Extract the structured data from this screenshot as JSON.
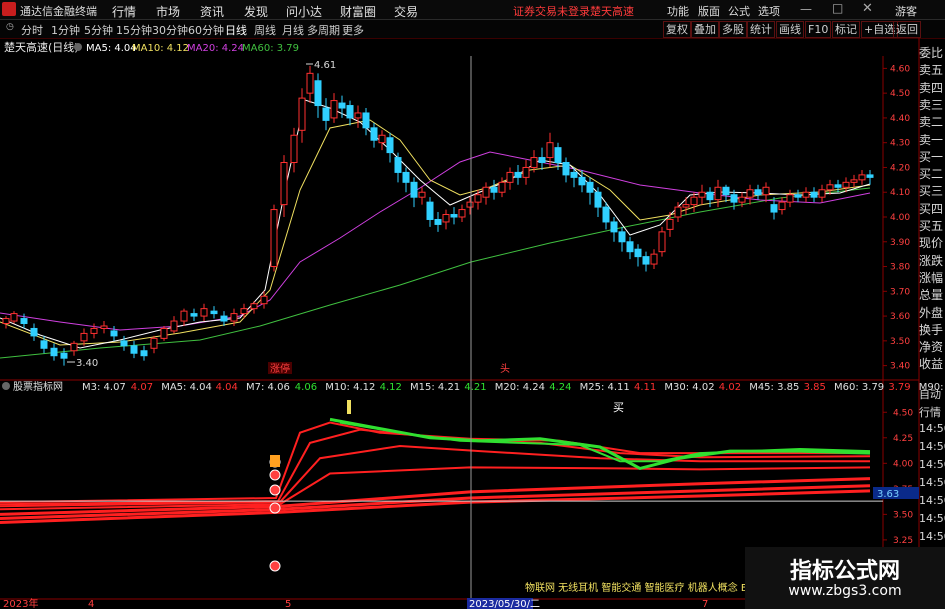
{
  "app": {
    "title": "通达信金融终端"
  },
  "menu": [
    "行情",
    "市场",
    "资讯",
    "发现",
    "问小达",
    "财富圈",
    "交易"
  ],
  "alerts": [
    "证券交易未登录",
    "楚天高速"
  ],
  "right_menu": [
    "功能",
    "版面",
    "公式",
    "选项",
    "游客"
  ],
  "periods": [
    "分时",
    "1分钟",
    "5分钟",
    "15分钟",
    "30分钟",
    "60分钟",
    "日线",
    "周线",
    "月线",
    "多周期",
    "更多"
  ],
  "tools": [
    "复权",
    "叠加",
    "多股",
    "统计",
    "画线",
    "F10",
    "标记",
    "+自选",
    "返回"
  ],
  "main_chart": {
    "stock_label": "楚天高速(日线)",
    "ma_labels": [
      "MA5: 4.04",
      "MA10: 4.12",
      "MA20: 4.24",
      "MA60: 3.79"
    ],
    "ma_colors": [
      "#ffffff",
      "#f0e060",
      "#d040e0",
      "#40c040"
    ],
    "price_axis": [
      "4.60",
      "4.50",
      "4.40",
      "4.30",
      "4.20",
      "4.10",
      "4.00",
      "3.90",
      "3.80",
      "3.70",
      "3.60",
      "3.50",
      "3.40"
    ],
    "annotations": {
      "high": "4.61",
      "low": "3.40",
      "tag1": "涨停",
      "tag2": "头"
    }
  },
  "sub_chart": {
    "name": "股票指标网",
    "items": [
      {
        "label": "M3: 4.07",
        "value": "4.07",
        "color": "#ff3030"
      },
      {
        "label": "MA5: 4.04",
        "value": "4.04",
        "color": "#ff3030"
      },
      {
        "label": "M7: 4.06",
        "value": "4.06",
        "color": "#30e030"
      },
      {
        "label": "M10: 4.12",
        "value": "4.12",
        "color": "#30e030"
      },
      {
        "label": "M15: 4.21",
        "value": "4.21",
        "color": "#30e030"
      },
      {
        "label": "M20: 4.24",
        "value": "4.24",
        "color": "#30e030"
      },
      {
        "label": "M25: 4.11",
        "value": "4.11",
        "color": "#ff3030"
      },
      {
        "label": "M30: 4.02",
        "value": "4.02",
        "color": "#ff3030"
      },
      {
        "label": "M45: 3.85",
        "value": "3.85",
        "color": "#ff3030"
      },
      {
        "label": "M60: 3.79",
        "value": "3.79",
        "color": "#ff3030"
      },
      {
        "label": "M90: 3.65",
        "value": "3.65",
        "color": "#ff3030"
      }
    ],
    "axis": [
      "4.50",
      "4.25",
      "4.00",
      "3.75",
      "3.50",
      "3.25"
    ],
    "current_value": "3.63",
    "buy_marker": "买"
  },
  "right_panel": [
    "委比",
    "卖五",
    "卖四",
    "卖三",
    "卖二",
    "卖一",
    "买一",
    "买二",
    "买三",
    "买四",
    "买五",
    "现价",
    "涨跌",
    "涨幅",
    "总量",
    "外盘",
    "换手",
    "净资",
    "收益"
  ],
  "right_panel_lower": [
    "自动",
    "行情",
    "14:50",
    "14:50",
    "14:50",
    "14:50",
    "14:50",
    "14:50",
    "14:50"
  ],
  "time_axis": [
    "2023年",
    "4",
    "5",
    "2023/05/30/二",
    "7"
  ],
  "ticker": "物联网 无线耳机 智能交通 智能医疗 机器人概念 ET",
  "watermark": {
    "line1": "指标公式网",
    "line2": "www.zbgs3.com"
  }
}
